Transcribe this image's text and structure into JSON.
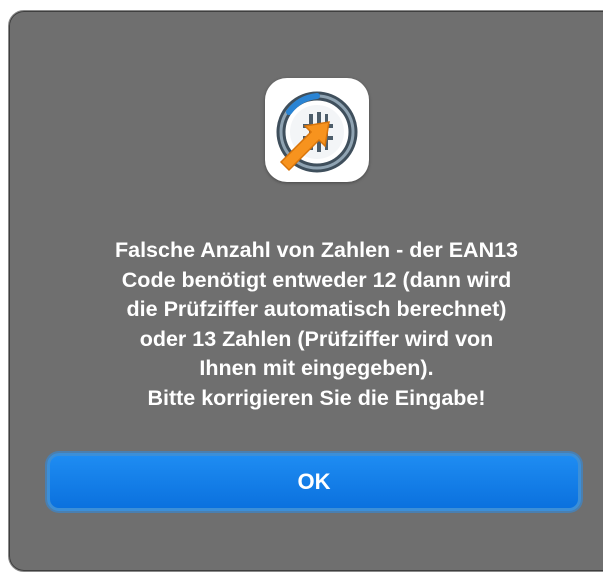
{
  "dialog": {
    "message_lines": [
      "Falsche Anzahl von Zahlen - der EAN13",
      "Code benötigt entweder 12 (dann wird",
      "die Prüfziffer automatisch berechnet)",
      "oder 13 Zahlen (Prüfziffer wird von",
      "Ihnen mit eingegeben).",
      "Bitte korrigieren Sie die Eingabe!"
    ],
    "ok_label": "OK",
    "icon": "barcode-app-icon"
  },
  "colors": {
    "dialog_background": "#6f6f6f",
    "button_accent": "#0b71de",
    "icon_orange": "#f7931e",
    "icon_steel": "#5a6b78"
  }
}
